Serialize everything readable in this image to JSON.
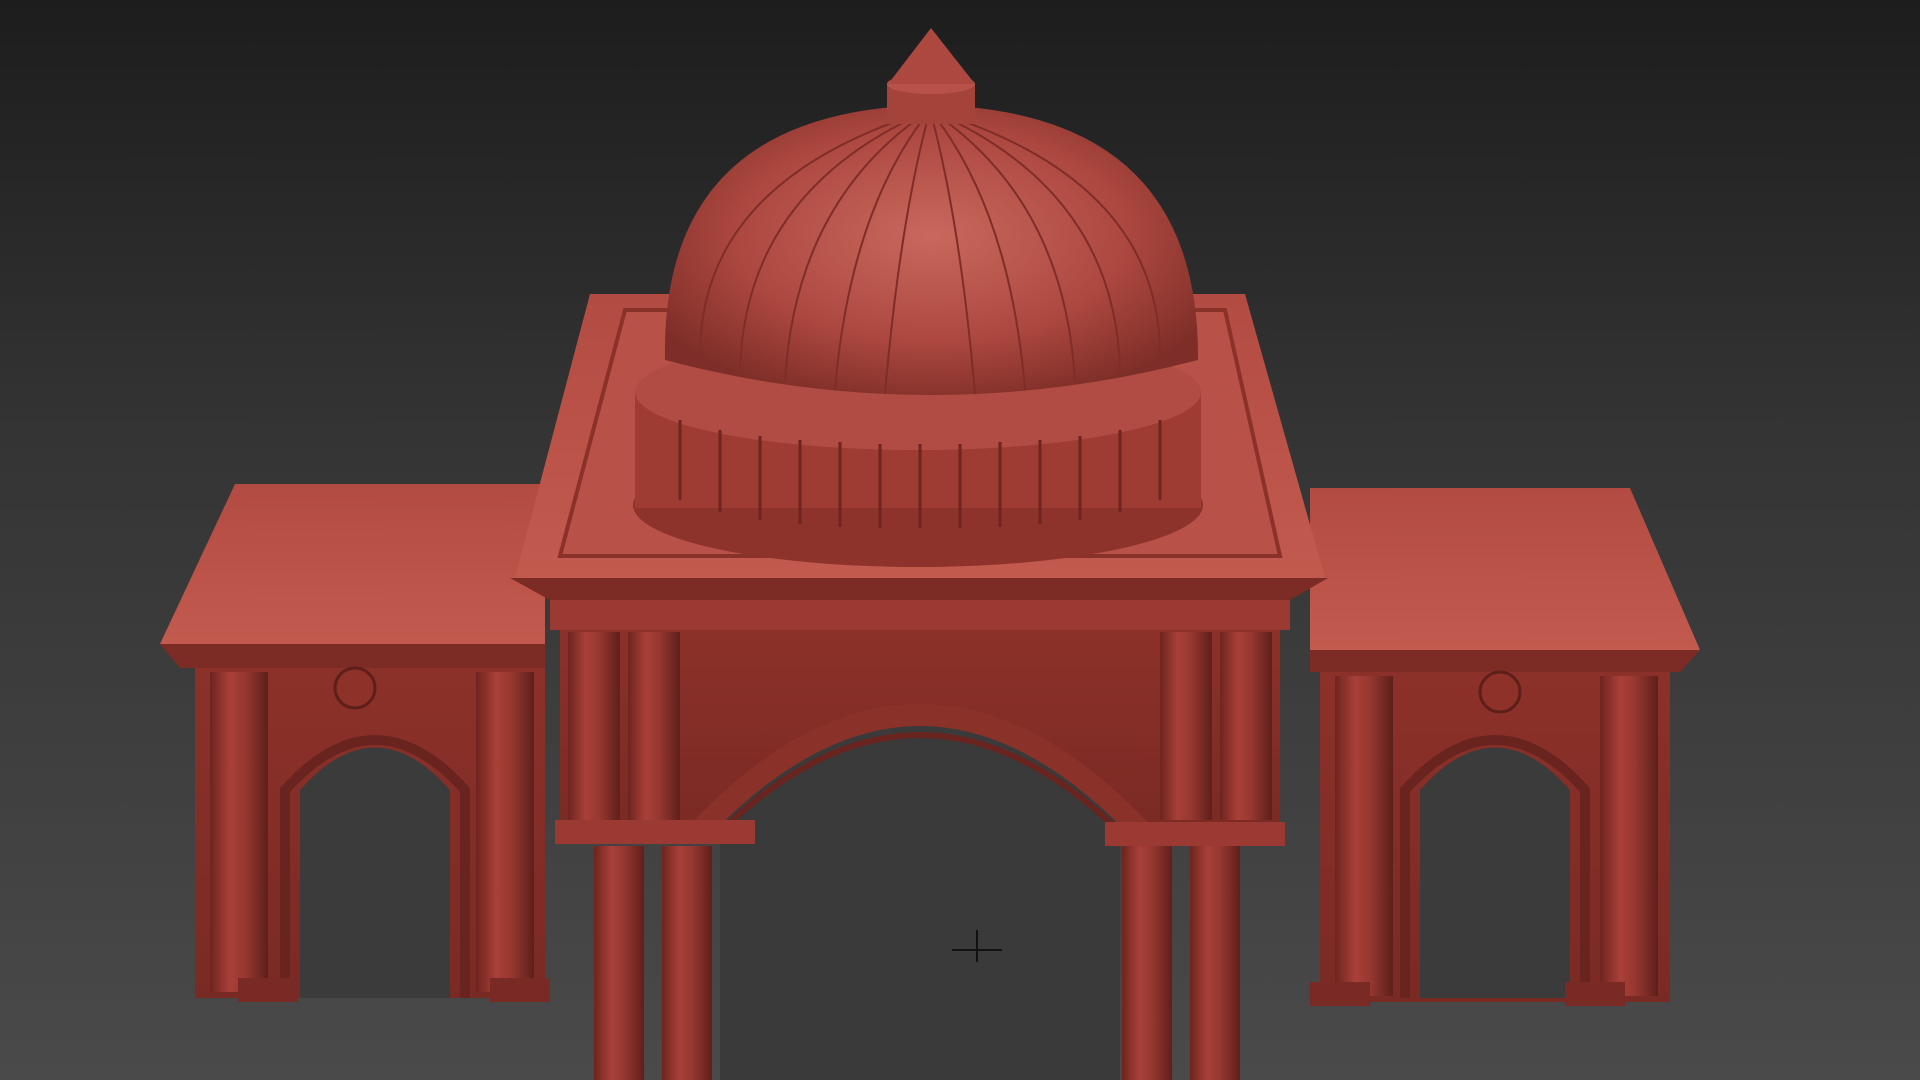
{
  "viewport": {
    "background_top": "#1d1d1d",
    "background_bottom": "#4a4a4a",
    "model_color": "#a8413a",
    "model_highlight": "#c25a50",
    "model_shadow": "#6e2420",
    "cursor_icon": "crosshair-icon"
  }
}
